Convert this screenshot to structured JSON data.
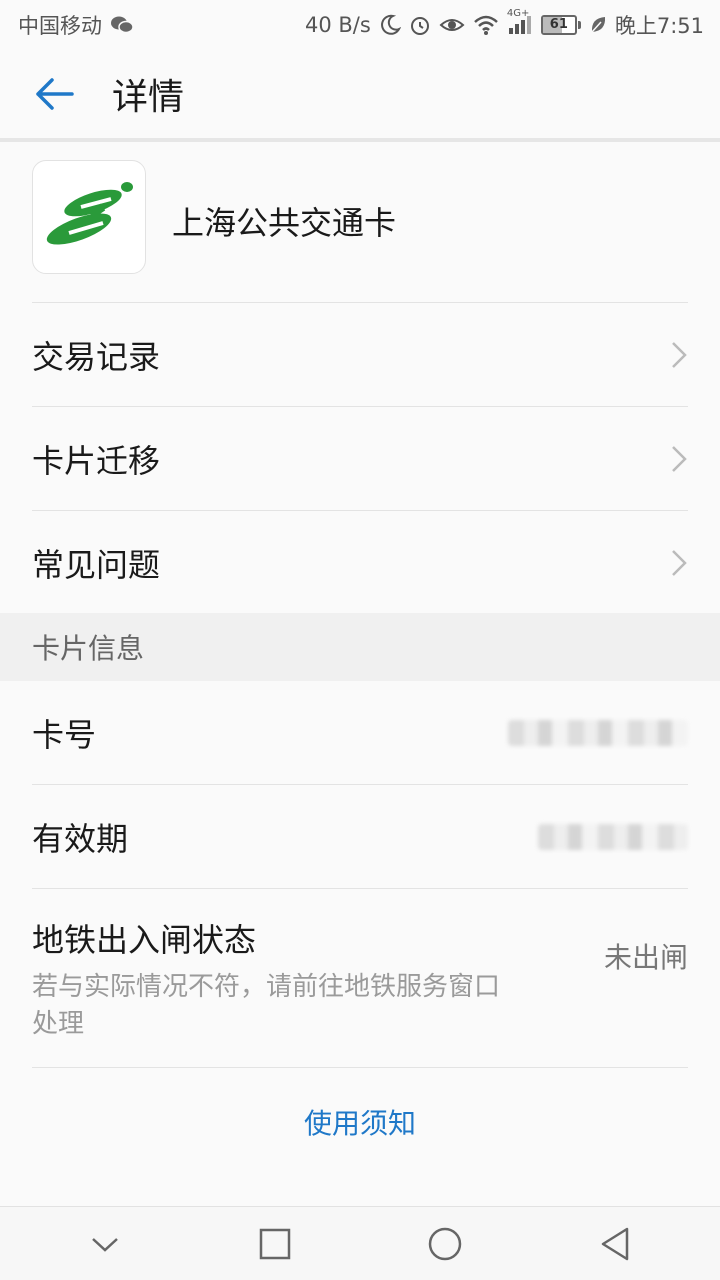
{
  "status_bar": {
    "carrier": "中国移动",
    "speed": "40 B/s",
    "network": "4G+",
    "battery": "61",
    "time": "晚上7:51",
    "icons": [
      "wechat-icon",
      "moon-icon",
      "alarm-icon",
      "eye-icon",
      "wifi-icon",
      "signal-icon",
      "battery-icon",
      "leaf-icon"
    ]
  },
  "header": {
    "title": "详情",
    "back_icon": "arrow-left-icon"
  },
  "card": {
    "name": "上海公共交通卡",
    "logo_color": "#2a9a3a"
  },
  "menu": [
    {
      "label": "交易记录"
    },
    {
      "label": "卡片迁移"
    },
    {
      "label": "常见问题"
    }
  ],
  "section": {
    "title": "卡片信息"
  },
  "info": {
    "card_number_label": "卡号",
    "validity_label": "有效期",
    "metro_title": "地铁出入闸状态",
    "metro_desc": "若与实际情况不符，请前往地铁服务窗口处理",
    "metro_value": "未出闸"
  },
  "notice": {
    "label": "使用须知"
  },
  "colors": {
    "accent": "#1f78c8",
    "logo_green": "#2a9a3a"
  },
  "nav_bar": {
    "icons": [
      "chevron-down-icon",
      "square-icon",
      "circle-icon",
      "triangle-back-icon"
    ]
  }
}
